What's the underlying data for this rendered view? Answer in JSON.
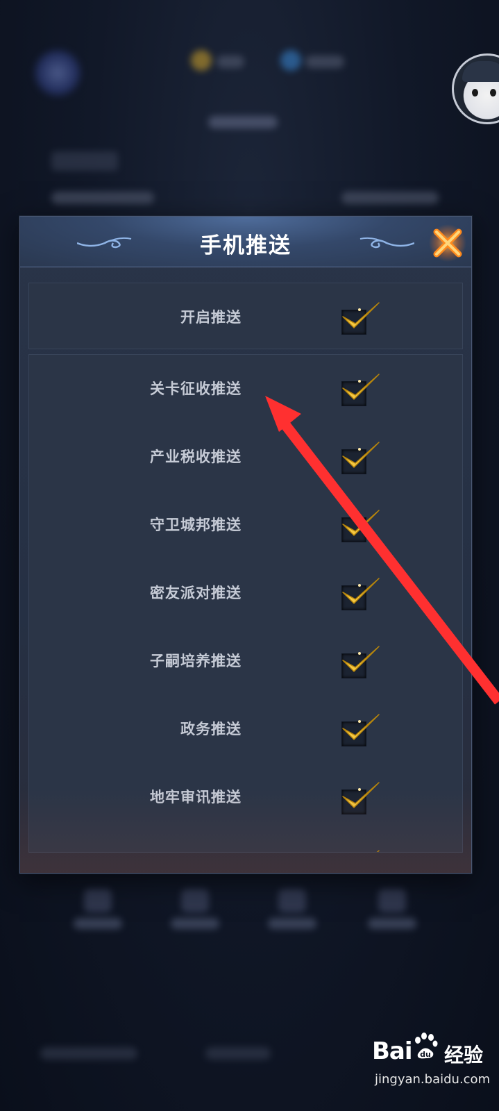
{
  "dialog": {
    "title": "手机推送",
    "close_icon": "close-x-icon",
    "master_toggle": {
      "label": "开启推送",
      "checked": true
    },
    "items": [
      {
        "label": "关卡征收推送",
        "checked": true
      },
      {
        "label": "产业税收推送",
        "checked": true
      },
      {
        "label": "守卫城邦推送",
        "checked": true
      },
      {
        "label": "密友派对推送",
        "checked": true
      },
      {
        "label": "子嗣培养推送",
        "checked": true
      },
      {
        "label": "政务推送",
        "checked": true
      },
      {
        "label": "地牢审讯推送",
        "checked": true
      },
      {
        "label": "",
        "checked": true
      }
    ]
  },
  "annotation": {
    "type": "red-arrow",
    "color": "#ff3030"
  },
  "watermark": {
    "brand": "Bai",
    "brand_suffix": "du",
    "product": "经验",
    "url": "jingyan.baidu.com"
  },
  "colors": {
    "check": "#f5c842",
    "title": "#ffffff",
    "label": "#c6cbd6",
    "accent": "#ff7a1a"
  }
}
